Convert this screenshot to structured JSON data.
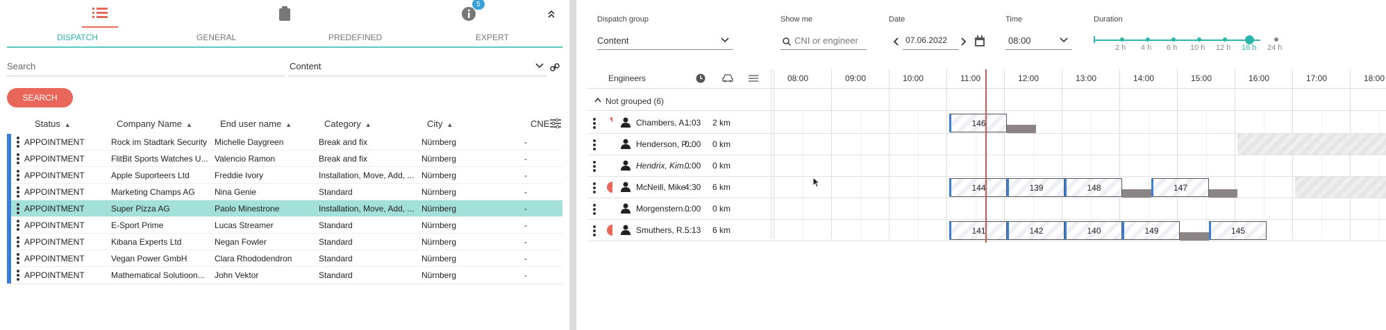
{
  "left": {
    "top_icons": {
      "badge": "5"
    },
    "tabs": [
      {
        "label": "DISPATCH"
      },
      {
        "label": "GENERAL"
      },
      {
        "label": "PREDEFINED"
      },
      {
        "label": "EXPERT"
      }
    ],
    "search": {
      "placeholder": "Search"
    },
    "content_select": {
      "value": "Content"
    },
    "search_button": {
      "label": "SEARCH"
    },
    "columns": [
      {
        "label": "Status"
      },
      {
        "label": "Company Name"
      },
      {
        "label": "End user name"
      },
      {
        "label": "Category"
      },
      {
        "label": "City"
      },
      {
        "label": "CNE"
      }
    ],
    "rows": [
      {
        "status": "APPOINTMENT",
        "company": "Rock im Stadtark Security",
        "user": "Michelle Daygreen",
        "category": "Break and fix",
        "city": "Nürnberg",
        "cne": "-"
      },
      {
        "status": "APPOINTMENT",
        "company": "FlitBit Sports Watches U...",
        "user": "Valencio Ramon",
        "category": "Break and fix",
        "city": "Nürnberg",
        "cne": "-"
      },
      {
        "status": "APPOINTMENT",
        "company": "Apple Suporteers Ltd",
        "user": "Freddie Ivory",
        "category": "Installation, Move, Add, ...",
        "city": "Nürnberg",
        "cne": "-"
      },
      {
        "status": "APPOINTMENT",
        "company": "Marketing Champs AG",
        "user": "Nina Genie",
        "category": "Standard",
        "city": "Nürnberg",
        "cne": "-"
      },
      {
        "status": "APPOINTMENT",
        "company": "Super Pizza AG",
        "user": "Paolo Minestrone",
        "category": "Installation, Move, Add, ...",
        "city": "Nürnberg",
        "cne": "-"
      },
      {
        "status": "APPOINTMENT",
        "company": "E-Sport Prime",
        "user": "Lucas Streamer",
        "category": "Standard",
        "city": "Nürnberg",
        "cne": "-"
      },
      {
        "status": "APPOINTMENT",
        "company": "Kibana Experts Ltd",
        "user": "Negan Fowler",
        "category": "Standard",
        "city": "Nürnberg",
        "cne": "-"
      },
      {
        "status": "APPOINTMENT",
        "company": "Vegan Power GmbH",
        "user": "Clara Rhododendron",
        "category": "Standard",
        "city": "Nürnberg",
        "cne": "-"
      },
      {
        "status": "APPOINTMENT",
        "company": "Mathematical Solutioon...",
        "user": "John Vektor",
        "category": "Standard",
        "city": "Nürnberg",
        "cne": "-"
      }
    ]
  },
  "right": {
    "dispatch_group": {
      "label": "Dispatch group",
      "value": "Content"
    },
    "show_me": {
      "label": "Show me",
      "placeholder": "CNI or engineer"
    },
    "date": {
      "label": "Date",
      "value": "07.06.2022"
    },
    "time": {
      "label": "Time",
      "value": "08:00"
    },
    "duration": {
      "label": "Duration",
      "options": [
        "2 h",
        "4 h",
        "6 h",
        "10 h",
        "12 h",
        "16 h",
        "24 h"
      ],
      "selected": "16 h"
    },
    "gantt_header": {
      "engineers": "Engineers",
      "hours": [
        "08:00",
        "09:00",
        "10:00",
        "11:00",
        "12:00",
        "13:00",
        "14:00",
        "15:00",
        "16:00",
        "17:00",
        "18:00"
      ]
    },
    "group": {
      "label": "Not grouped (6)"
    },
    "engineers": [
      {
        "name": "Chambers, A...",
        "time": "1:03",
        "km": "2 km",
        "tasks": [
          "146"
        ]
      },
      {
        "name": "Henderson, P...",
        "time": "0:00",
        "km": "0 km",
        "tasks": []
      },
      {
        "name": "Hendrix, Kim...",
        "time": "0:00",
        "km": "0 km",
        "tasks": []
      },
      {
        "name": "McNeill, Mike",
        "time": "4:30",
        "km": "6 km",
        "tasks": [
          "144",
          "139",
          "148",
          "147"
        ]
      },
      {
        "name": "Morgenstern...",
        "time": "0:00",
        "km": "0 km",
        "tasks": []
      },
      {
        "name": "Smuthers, R...",
        "time": "5:13",
        "km": "6 km",
        "tasks": [
          "141",
          "142",
          "140",
          "149",
          "145"
        ]
      }
    ]
  },
  "colors": {
    "accent": "#e8675a",
    "teal": "#2bb5ab",
    "selected_row": "#a3e0da",
    "status_bar": "#3a7fd5",
    "now_line": "#d9534f"
  }
}
